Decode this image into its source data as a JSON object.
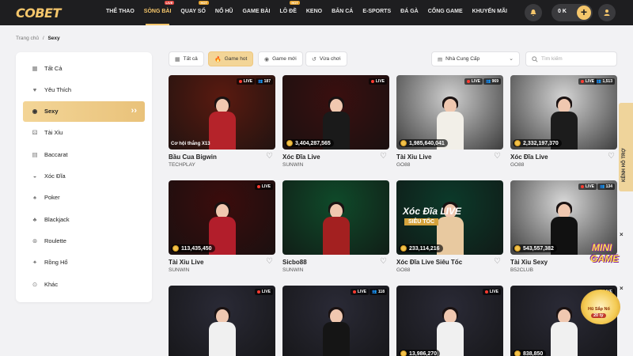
{
  "header": {
    "logo": "COBET",
    "nav": [
      {
        "label": "THỂ THAO",
        "badge": ""
      },
      {
        "label": "SÒNG BÀI",
        "badge": "LIVE",
        "badge_color": "red",
        "active": true
      },
      {
        "label": "QUAY SỐ",
        "badge": "HOT",
        "badge_color": "orange"
      },
      {
        "label": "NỔ HŨ",
        "badge": ""
      },
      {
        "label": "GAME BÀI",
        "badge": ""
      },
      {
        "label": "LÔ ĐỀ",
        "badge": "HOT",
        "badge_color": "orange"
      },
      {
        "label": "KENO",
        "badge": ""
      },
      {
        "label": "BẮN CÁ",
        "badge": ""
      },
      {
        "label": "E-SPORTS",
        "badge": ""
      },
      {
        "label": "ĐÁ GÀ",
        "badge": ""
      },
      {
        "label": "CỔNG GAME",
        "badge": ""
      },
      {
        "label": "KHUYẾN MÃI",
        "badge": ""
      }
    ],
    "balance": "0 K",
    "icons": {
      "bell": "bell-icon",
      "plus": "plus-icon",
      "user": "user-icon"
    }
  },
  "breadcrumb": {
    "home": "Trang chủ",
    "sep": "/",
    "current": "Sexy"
  },
  "sidebar": {
    "items": [
      {
        "label": "Tất Cả",
        "icon": "grid-icon"
      },
      {
        "label": "Yêu Thích",
        "icon": "heart-icon"
      },
      {
        "label": "Sexy",
        "icon": "lips-icon",
        "active": true
      },
      {
        "label": "Tài Xỉu",
        "icon": "dice-icon"
      },
      {
        "label": "Baccarat",
        "icon": "cards-icon"
      },
      {
        "label": "Xóc Đĩa",
        "icon": "bowl-icon"
      },
      {
        "label": "Poker",
        "icon": "poker-icon"
      },
      {
        "label": "Blackjack",
        "icon": "blackjack-icon"
      },
      {
        "label": "Roulette",
        "icon": "roulette-icon"
      },
      {
        "label": "Rồng Hổ",
        "icon": "dragon-icon"
      },
      {
        "label": "Khác",
        "icon": "more-icon"
      }
    ]
  },
  "filters": {
    "chips": [
      {
        "label": "Tất cả",
        "icon": "grid-icon"
      },
      {
        "label": "Game hot",
        "icon": "fire-icon",
        "active": true
      },
      {
        "label": "Game mới",
        "icon": "new-icon"
      },
      {
        "label": "Vừa chơi",
        "icon": "history-icon"
      }
    ],
    "provider": "Nhà Cung Cấp",
    "search_placeholder": "Tìm kiếm"
  },
  "games": [
    {
      "title": "Bầu Cua Bigwin",
      "provider": "TECHPLAY",
      "live": "LIVE",
      "viewers": "187",
      "promo": "Cơ hội thắng X13",
      "bg": "#5a1a10",
      "body": "#b5232a"
    },
    {
      "title": "Xóc Đĩa Live",
      "provider": "SUNWIN",
      "live": "LIVE",
      "viewers": "",
      "jackpot": "3,404,287,565",
      "bg": "#3a0f0f",
      "body": "#1a1a1a"
    },
    {
      "title": "Tài Xỉu Live",
      "provider": "GO88",
      "live": "LIVE",
      "viewers": "969",
      "jackpot": "1,985,640,041",
      "bg": "#cfcfcf",
      "body": "#f2efe8"
    },
    {
      "title": "Xóc Đĩa Live",
      "provider": "GO88",
      "live": "LIVE",
      "viewers": "1,513",
      "jackpot": "2,332,197,370",
      "bg": "#d4d4d4",
      "body": "#1c1c1c"
    },
    {
      "title": "Tài Xỉu Live",
      "provider": "SUNWIN",
      "live": "LIVE",
      "viewers": "",
      "jackpot": "113,435,450",
      "bg": "#3b0c0c",
      "body": "#b21e2b"
    },
    {
      "title": "Sicbo88",
      "provider": "SUNWIN",
      "live": "",
      "viewers": "",
      "jackpot": "",
      "bg": "#0f4a2a",
      "body": "#a32020"
    },
    {
      "title": "Xóc Đĩa Live Siêu Tốc",
      "provider": "GO88",
      "live": "",
      "viewers": "",
      "jackpot": "233,114,216",
      "overlay": "Xóc Đĩa LIVE",
      "overlay_sub": "SIÊU TỐC",
      "bg": "#0c3a2a",
      "body": "#e8c9a0"
    },
    {
      "title": "Tài Xỉu Sexy",
      "provider": "B52CLUB",
      "live": "LIVE",
      "viewers": "134",
      "jackpot": "543,557,382",
      "bg": "#d8d8d8",
      "body": "#111"
    },
    {
      "title": "",
      "provider": "",
      "live": "LIVE",
      "viewers": "",
      "bg": "#2a2a36",
      "body": "#f0f0f0"
    },
    {
      "title": "",
      "provider": "",
      "live": "LIVE",
      "viewers": "118",
      "bg": "#2a2a36",
      "body": "#151515"
    },
    {
      "title": "",
      "provider": "",
      "live": "LIVE",
      "viewers": "",
      "jackpot": "13,986,270",
      "bg": "#2a2a36",
      "body": "#f0f0f0"
    },
    {
      "title": "",
      "provider": "",
      "live": "LIVE",
      "viewers": "",
      "jackpot": "838,850",
      "bg": "#2a2a36",
      "body": "#f0f0f0"
    }
  ],
  "widgets": {
    "support": "KÊNH HỖ TRỢ",
    "mini_game_1": "MINI",
    "mini_game_2": "GAME",
    "hu_label": "Hũ Sắp Nổ",
    "hu_value": "20 tỷ"
  },
  "colors": {
    "accent": "#f5c66b",
    "header_bg": "#1e1e20",
    "active_bg": "#f3d597"
  }
}
